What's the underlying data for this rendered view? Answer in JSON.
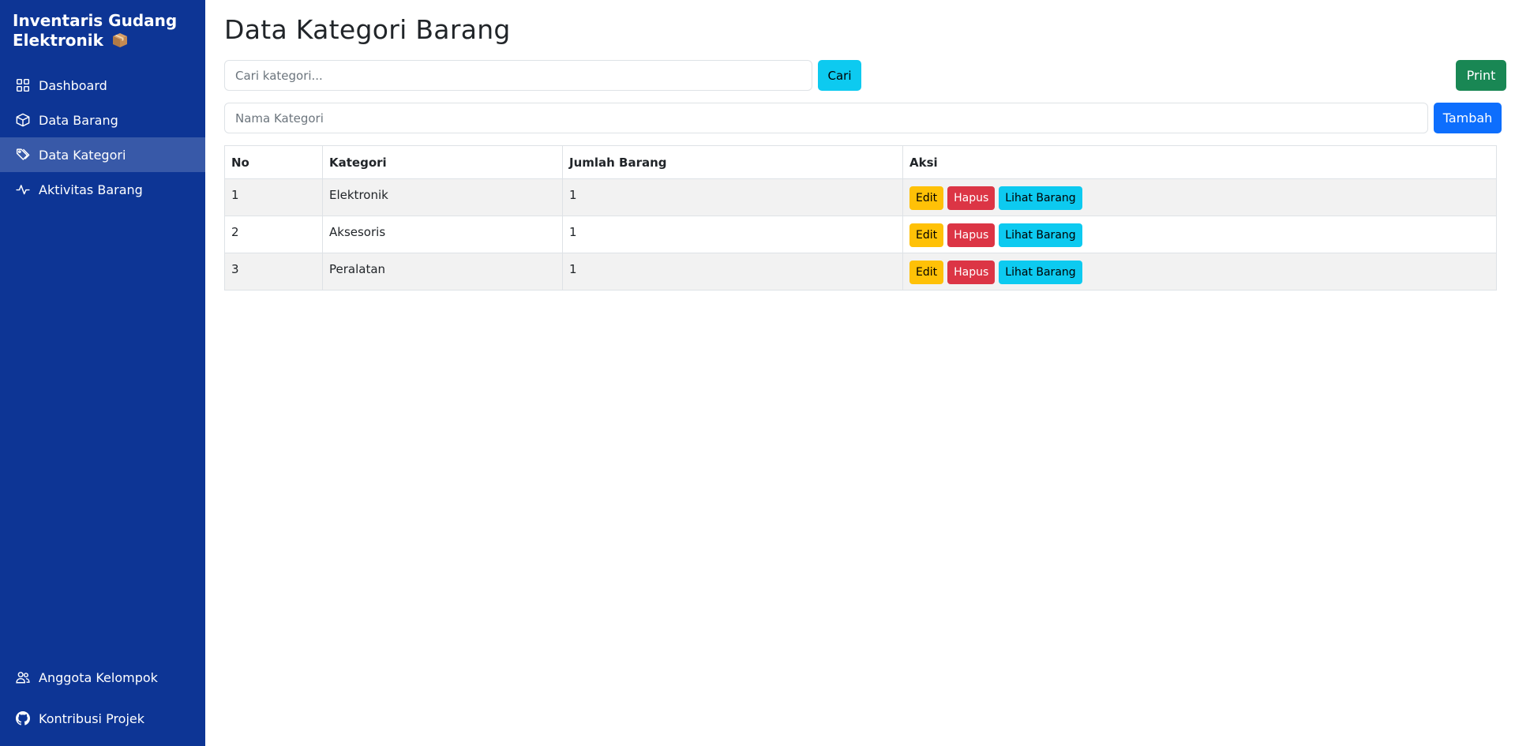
{
  "sidebar": {
    "brand": "Inventaris Gudang Elektronik",
    "brand_icon": "package-icon",
    "items": [
      {
        "label": "Dashboard",
        "icon": "grid-icon",
        "active": false
      },
      {
        "label": "Data Barang",
        "icon": "box-icon",
        "active": false
      },
      {
        "label": "Data Kategori",
        "icon": "tags-icon",
        "active": true
      },
      {
        "label": "Aktivitas Barang",
        "icon": "activity-icon",
        "active": false
      }
    ],
    "footer_items": [
      {
        "label": "Anggota Kelompok",
        "icon": "people-icon"
      },
      {
        "label": "Kontribusi Projek",
        "icon": "github-icon"
      }
    ]
  },
  "main": {
    "title": "Data Kategori Barang",
    "search": {
      "placeholder": "Cari kategori...",
      "value": "",
      "button": "Cari"
    },
    "print_button": "Print",
    "add": {
      "placeholder": "Nama Kategori",
      "value": "",
      "button": "Tambah"
    },
    "table": {
      "headers": [
        "No",
        "Kategori",
        "Jumlah Barang",
        "Aksi"
      ],
      "rows": [
        {
          "no": "1",
          "kategori": "Elektronik",
          "jumlah": "1"
        },
        {
          "no": "2",
          "kategori": "Aksesoris",
          "jumlah": "1"
        },
        {
          "no": "3",
          "kategori": "Peralatan",
          "jumlah": "1"
        }
      ],
      "actions": {
        "edit": "Edit",
        "delete": "Hapus",
        "view": "Lihat Barang"
      }
    }
  },
  "colors": {
    "sidebar_bg": "#0d3595",
    "info": "#0dcaf0",
    "success": "#198754",
    "primary": "#0d6efd",
    "warning": "#ffc107",
    "danger": "#dc3545"
  }
}
